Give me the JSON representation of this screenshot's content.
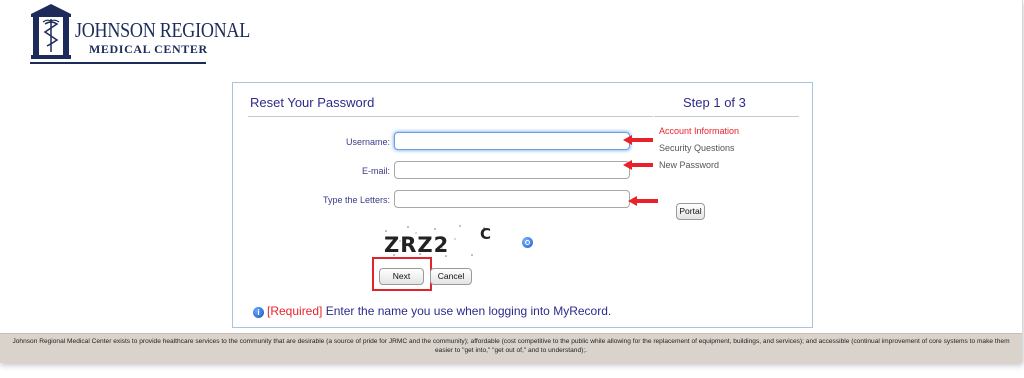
{
  "logo": {
    "line1": "JOHNSON REGIONAL",
    "line2": "MEDICAL CENTER"
  },
  "form": {
    "title": "Reset Your Password",
    "step": "Step 1 of 3",
    "fields": {
      "username_label": "Username:",
      "username_value": "",
      "email_label": "E-mail:",
      "email_value": "",
      "letters_label": "Type the Letters:",
      "letters_value": ""
    },
    "captcha_text": "ZRZ2C",
    "buttons": {
      "portal": "Portal",
      "next": "Next",
      "cancel": "Cancel"
    },
    "help": {
      "required": "[Required]",
      "message": " Enter the name you use when logging into MyRecord."
    }
  },
  "steps": [
    {
      "label": "Account Information",
      "active": true
    },
    {
      "label": "Security Questions",
      "active": false
    },
    {
      "label": "New Password",
      "active": false
    }
  ],
  "footer": {
    "text": "Johnson Regional Medical Center exists to provide healthcare services to the community that are desirable (a source of pride for JRMC and the community); affordable (cost competitive to the public while allowing for the replacement of equipment, buildings, and services); and accessible (continual improvement of core systems to make them easier to \"get into,\" \"get out of,\" and to understand);."
  },
  "colors": {
    "title": "#2e2a8c",
    "active_step": "#e8222a",
    "annotation_red": "#e0242b",
    "panel_border": "#a9c4df",
    "footer_bg": "#d9d3cc"
  },
  "icons": [
    "hospital-logo-icon",
    "arrow-left-icon",
    "refresh-icon",
    "info-icon"
  ]
}
